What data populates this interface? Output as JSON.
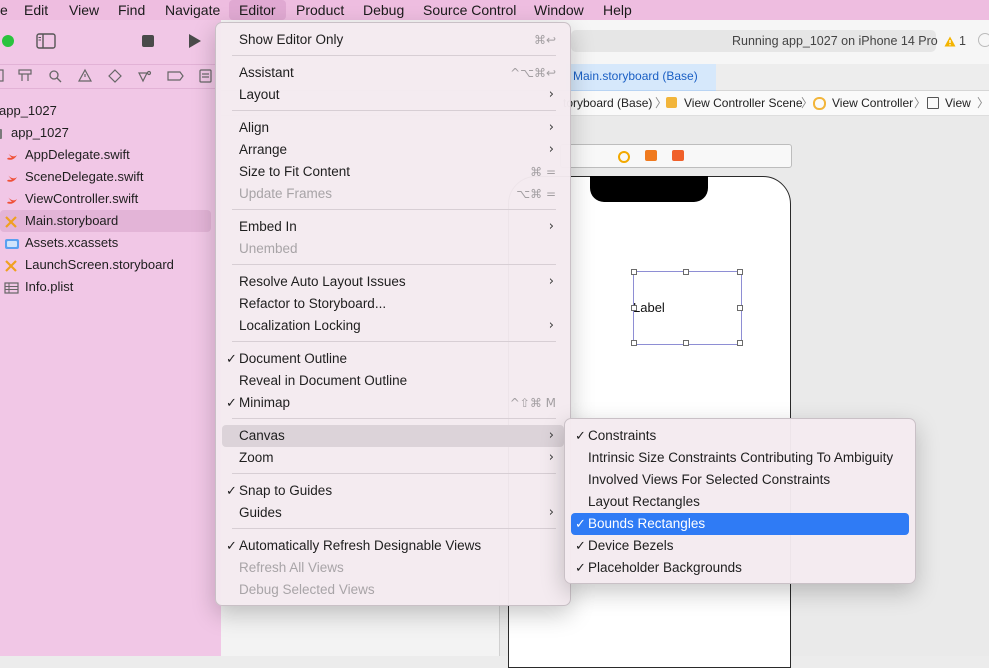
{
  "menubar": {
    "items": [
      "e",
      "Edit",
      "View",
      "Find",
      "Navigate",
      "Editor",
      "Product",
      "Debug",
      "Source Control",
      "Window",
      "Help"
    ],
    "active": "Editor"
  },
  "toolbar": {
    "status": "Running app_1027 on iPhone 14 Pro",
    "warning_count": "1",
    "active_tab": "Main.storyboard (Base)"
  },
  "jumpbar": {
    "items": [
      "toryboard (Base)",
      "View Controller Scene",
      "View Controller",
      "View"
    ]
  },
  "sidebar": {
    "items": [
      {
        "label": "app_1027",
        "icon": "project-icon"
      },
      {
        "label": "app_1027",
        "icon": "folder-icon"
      },
      {
        "label": "AppDelegate.swift",
        "icon": "swift-icon"
      },
      {
        "label": "SceneDelegate.swift",
        "icon": "swift-icon"
      },
      {
        "label": "ViewController.swift",
        "icon": "swift-icon"
      },
      {
        "label": "Main.storyboard",
        "icon": "storyboard-icon"
      },
      {
        "label": "Assets.xcassets",
        "icon": "assets-icon"
      },
      {
        "label": "LaunchScreen.storyboard",
        "icon": "storyboard-icon"
      },
      {
        "label": "Info.plist",
        "icon": "plist-icon"
      }
    ]
  },
  "canvas": {
    "label_text": "Label"
  },
  "editor_menu": {
    "items": [
      {
        "label": "Show Editor Only",
        "shortcut": "⌘↩"
      },
      {
        "label": "Assistant",
        "shortcut": "^⌥⌘↩"
      },
      {
        "label": "Layout"
      },
      {
        "label": "Align"
      },
      {
        "label": "Arrange"
      },
      {
        "label": "Size to Fit Content",
        "shortcut": "⌘ ="
      },
      {
        "label": "Update Frames",
        "shortcut": "⌥⌘ ="
      },
      {
        "label": "Embed In"
      },
      {
        "label": "Unembed"
      },
      {
        "label": "Resolve Auto Layout Issues"
      },
      {
        "label": "Refactor to Storyboard..."
      },
      {
        "label": "Localization Locking"
      },
      {
        "label": "Document Outline"
      },
      {
        "label": "Reveal in Document Outline"
      },
      {
        "label": "Minimap",
        "shortcut": "^⇧⌘ M"
      },
      {
        "label": "Canvas"
      },
      {
        "label": "Zoom"
      },
      {
        "label": "Snap to Guides"
      },
      {
        "label": "Guides"
      },
      {
        "label": "Automatically Refresh Designable Views"
      },
      {
        "label": "Refresh All Views"
      },
      {
        "label": "Debug Selected Views"
      }
    ]
  },
  "canvas_submenu": {
    "items": [
      {
        "label": "Constraints"
      },
      {
        "label": "Intrinsic Size Constraints Contributing To Ambiguity"
      },
      {
        "label": "Involved Views For Selected Constraints"
      },
      {
        "label": "Layout Rectangles"
      },
      {
        "label": "Bounds Rectangles"
      },
      {
        "label": "Device Bezels"
      },
      {
        "label": "Placeholder Backgrounds"
      }
    ]
  },
  "colors": {
    "menubar_bg": "#eebde0",
    "sidebar_bg": "#f1c7e6",
    "selection_blue": "#2f7bf5",
    "warning": "#f4b400"
  }
}
